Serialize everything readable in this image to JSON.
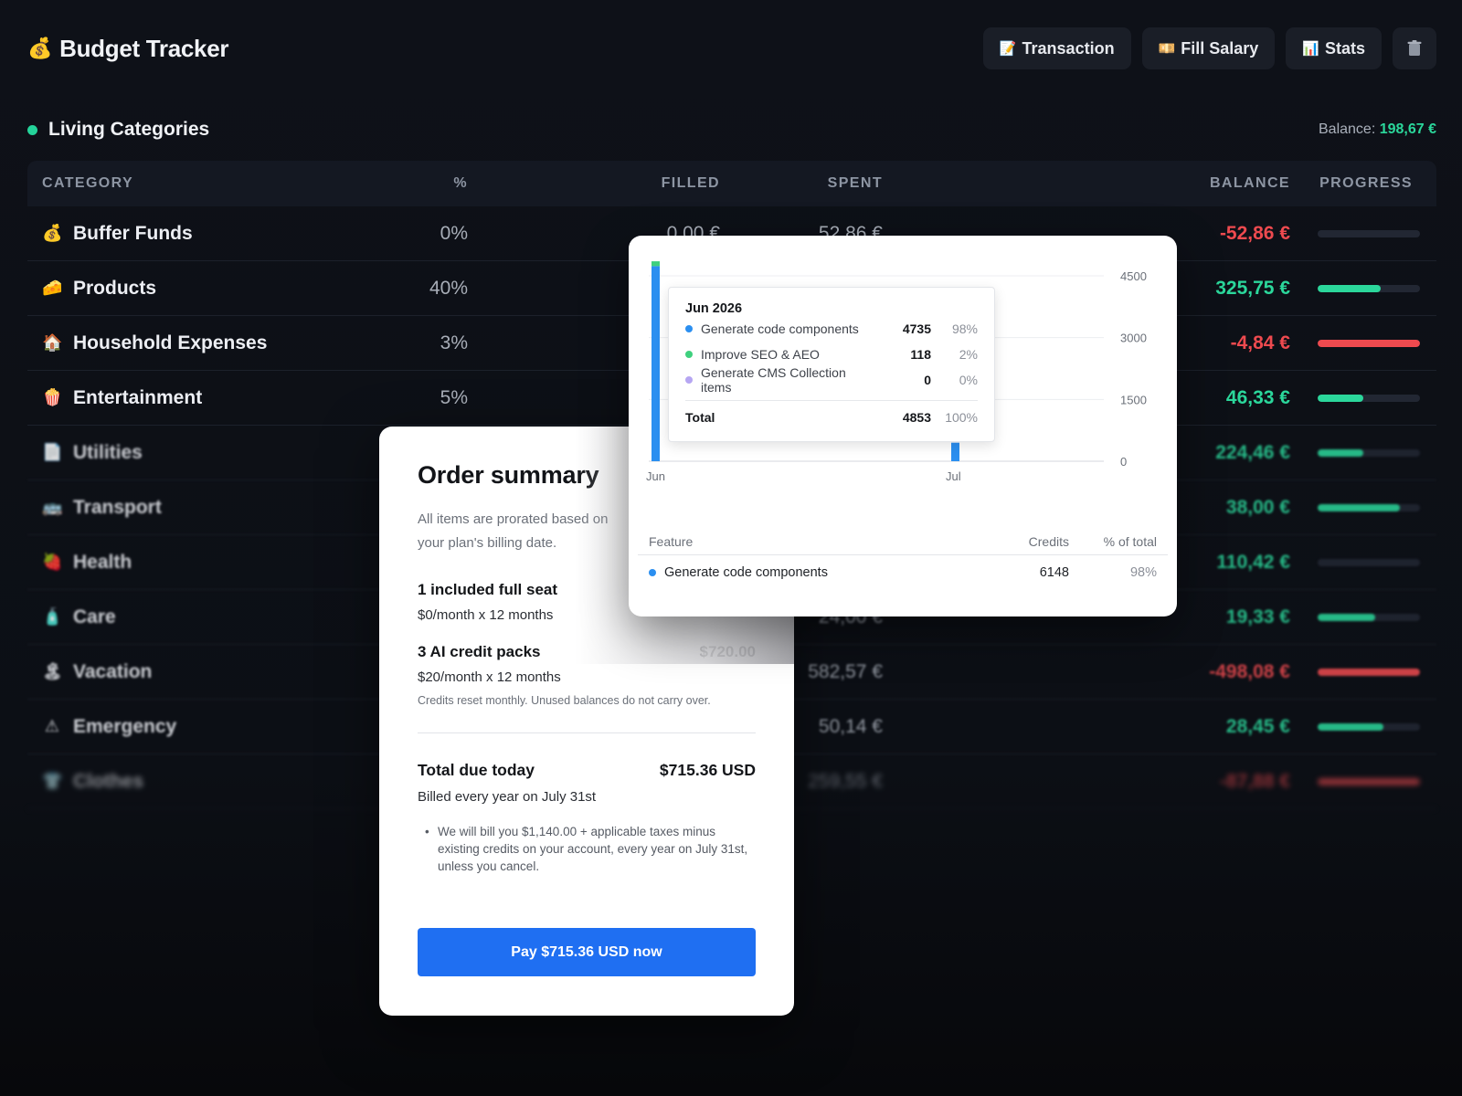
{
  "app": {
    "title": "Budget Tracker",
    "title_icon": "money-bag",
    "actions": [
      {
        "label": "Transaction",
        "icon": "memo"
      },
      {
        "label": "Fill Salary",
        "icon": "money-banknote"
      },
      {
        "label": "Stats",
        "icon": "bar-chart"
      },
      {
        "label": "",
        "icon": "trash-can"
      }
    ]
  },
  "section": {
    "title": "Living Categories",
    "balance_label": "Balance:",
    "balance_value": "198,67 €"
  },
  "table": {
    "headers": {
      "category": "CATEGORY",
      "percent": "%",
      "filled": "FILLED",
      "spent": "SPENT",
      "balance": "BALANCE",
      "progress": "PROGRESS"
    },
    "rows": [
      {
        "icon": "💰",
        "name": "Buffer Funds",
        "percent": "0%",
        "filled": "0,00 €",
        "spent": "52,86 €",
        "balance": "-52,86 €",
        "status": "neg",
        "progress": 0
      },
      {
        "icon": "🧀",
        "name": "Products",
        "percent": "40%",
        "filled": "",
        "spent": "",
        "balance": "325,75 €",
        "status": "pos",
        "progress": 0.62
      },
      {
        "icon": "🏠",
        "name": "Household Expenses",
        "percent": "3%",
        "filled": "",
        "spent": "",
        "balance": "-4,84 €",
        "status": "neg",
        "progress": 1
      },
      {
        "icon": "🍿",
        "name": "Entertainment",
        "percent": "5%",
        "filled": "",
        "spent": "",
        "balance": "46,33 €",
        "status": "pos",
        "progress": 0.45
      },
      {
        "icon": "📄",
        "name": "Utilities",
        "percent": "",
        "filled": "",
        "spent": "",
        "balance": "224,46 €",
        "status": "pos",
        "progress": 0.45
      },
      {
        "icon": "🚌",
        "name": "Transport",
        "percent": "",
        "filled": "",
        "spent": "",
        "balance": "38,00 €",
        "status": "pos",
        "progress": 0.8
      },
      {
        "icon": "🍓",
        "name": "Health",
        "percent": "",
        "filled": "",
        "spent": "",
        "balance": "110,42 €",
        "status": "pos",
        "progress": 0
      },
      {
        "icon": "🧴",
        "name": "Care",
        "percent": "",
        "filled": "",
        "spent": "24,00 €",
        "balance": "19,33 €",
        "status": "pos",
        "progress": 0.56
      },
      {
        "icon": "🏝",
        "name": "Vacation",
        "percent": "",
        "filled": "",
        "spent": "582,57 €",
        "balance": "-498,08 €",
        "status": "neg",
        "progress": 1
      },
      {
        "icon": "⚠",
        "name": "Emergency",
        "percent": "",
        "filled": "",
        "spent": "50,14 €",
        "balance": "28,45 €",
        "status": "pos",
        "progress": 0.64
      },
      {
        "icon": "👕",
        "name": "Clothes",
        "percent": "",
        "filled": "",
        "spent": "259,55 €",
        "balance": "-87,88 €",
        "status": "neg",
        "progress": 1
      }
    ]
  },
  "order": {
    "title": "Order summary",
    "subtitle": "All items are prorated based on your plan's billing date.",
    "items": [
      {
        "name": "1 included full seat",
        "price": "",
        "sub": "$0/month x 12 months",
        "note": ""
      },
      {
        "name": "3 AI credit packs",
        "price": "$720.00",
        "sub": "$20/month x 12 months",
        "note": "Credits reset monthly. Unused balances do not carry over."
      }
    ],
    "total_label": "Total due today",
    "total_value": "$715.36 USD",
    "billed": "Billed every year on July 31st",
    "bullet": "We will bill you $1,140.00 + applicable taxes minus existing credits on your account, every year on July 31st, unless you cancel.",
    "pay_label": "Pay $715.36 USD now"
  },
  "credits": {
    "tooltip": {
      "title": "Jun 2026",
      "rows": [
        {
          "name": "Generate code components",
          "value": "4735",
          "pct": "98%",
          "color": "#2b8ff0"
        },
        {
          "name": "Improve SEO & AEO",
          "value": "118",
          "pct": "2%",
          "color": "#3fd07e"
        },
        {
          "name": "Generate CMS Collection items",
          "value": "0",
          "pct": "0%",
          "color": "#b6a6f2"
        }
      ],
      "total_label": "Total",
      "total_value": "4853",
      "total_pct": "100%"
    },
    "feature_table": {
      "headers": {
        "feature": "Feature",
        "credits": "Credits",
        "pct": "% of total"
      },
      "rows": [
        {
          "name": "Generate code components",
          "credits": "6148",
          "pct": "98%",
          "color": "#2b8ff0"
        }
      ]
    }
  },
  "chart_data": {
    "type": "bar",
    "stacked": true,
    "categories": [
      "Jun",
      "Jul"
    ],
    "series": [
      {
        "name": "Generate code components",
        "values": [
          4735,
          450
        ],
        "color": "#2b8ff0"
      },
      {
        "name": "Improve SEO & AEO",
        "values": [
          118,
          0
        ],
        "color": "#3fd07e"
      },
      {
        "name": "Generate CMS Collection items",
        "values": [
          0,
          0
        ],
        "color": "#b6a6f2"
      }
    ],
    "ylim": [
      0,
      4500
    ],
    "yticks": [
      0,
      1500,
      3000,
      4500
    ],
    "grid": true
  }
}
